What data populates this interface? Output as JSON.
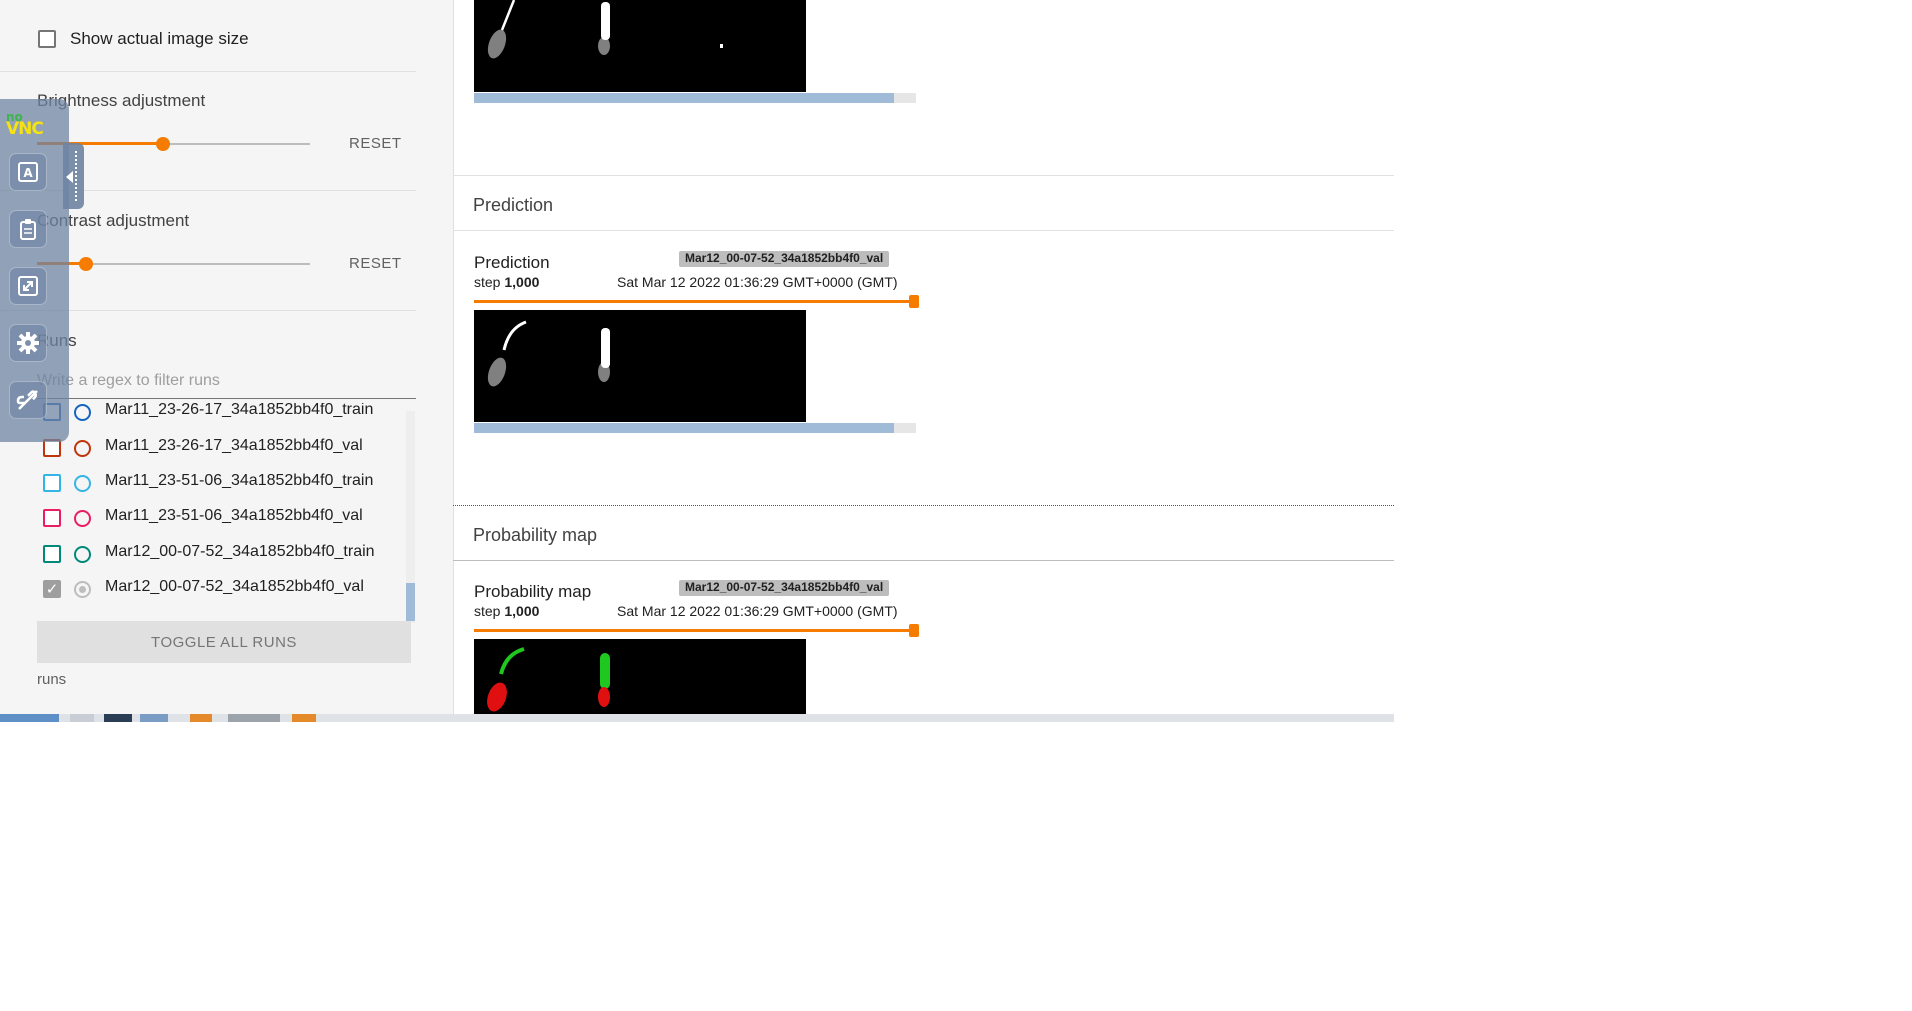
{
  "sidebar": {
    "show_actual_size": {
      "label": "Show actual image size",
      "checked": false
    },
    "brightness": {
      "label": "Brightness adjustment",
      "reset_label": "RESET",
      "value_fraction": 0.46
    },
    "contrast": {
      "label": "Contrast adjustment",
      "reset_label": "RESET",
      "value_fraction": 0.18
    },
    "runs": {
      "title": "Runs",
      "filter_placeholder": "Write a regex to filter runs",
      "items": [
        {
          "label": "Mar11_23-26-17_34a1852bb4f0_train",
          "checked": false,
          "color": "#1565c0",
          "selected": false
        },
        {
          "label": "Mar11_23-26-17_34a1852bb4f0_val",
          "checked": false,
          "color": "#bf360c",
          "selected": false
        },
        {
          "label": "Mar11_23-51-06_34a1852bb4f0_train",
          "checked": false,
          "color": "#33b5e5",
          "selected": false
        },
        {
          "label": "Mar11_23-51-06_34a1852bb4f0_val",
          "checked": false,
          "color": "#e91e63",
          "selected": false
        },
        {
          "label": "Mar12_00-07-52_34a1852bb4f0_train",
          "checked": false,
          "color": "#00897b",
          "selected": false
        },
        {
          "label": "Mar12_00-07-52_34a1852bb4f0_val",
          "checked": true,
          "color": "#bdbdbd",
          "selected": true
        }
      ],
      "toggle_all_label": "TOGGLE ALL RUNS",
      "footer": "runs"
    }
  },
  "novnc": {
    "logo_top": "no",
    "logo_bottom": "VNC",
    "buttons": [
      "keyboard-icon",
      "clipboard-icon",
      "fullscreen-icon",
      "settings-icon",
      "disconnect-icon"
    ]
  },
  "main": {
    "top_card": {
      "progress_fraction": 0.95
    },
    "sections": [
      {
        "header": "Prediction",
        "card": {
          "title": "Prediction",
          "step_label": "step",
          "step_value": "1,000",
          "run": "Mar12_00-07-52_34a1852bb4f0_val",
          "timestamp": "Sat Mar 12 2022 01:36:29 GMT+0000 (GMT)",
          "progress_fraction": 0.95
        }
      },
      {
        "header": "Probability map",
        "card": {
          "title": "Probability map",
          "step_label": "step",
          "step_value": "1,000",
          "run": "Mar12_00-07-52_34a1852bb4f0_val",
          "timestamp": "Sat Mar 12 2022 01:36:29 GMT+0000 (GMT)"
        }
      }
    ]
  },
  "colors": {
    "accent": "#f57c00",
    "progress": "#a0bbd7",
    "novnc_panel": "#6e84a3"
  }
}
